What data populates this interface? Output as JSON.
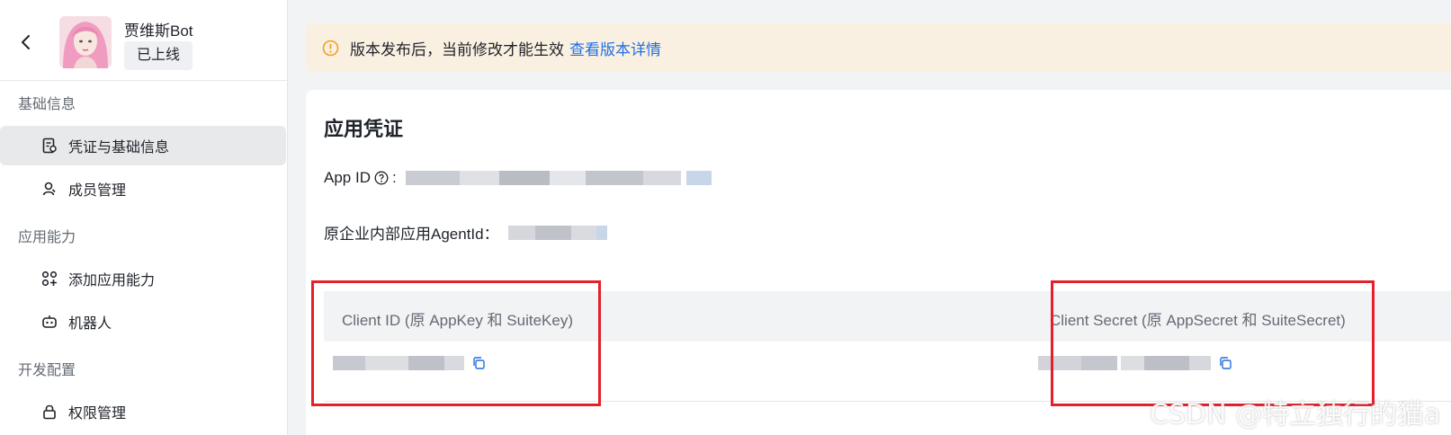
{
  "header": {
    "app_name": "贾维斯Bot",
    "status": "已上线"
  },
  "sidebar": {
    "groups": [
      {
        "label": "基础信息",
        "items": [
          {
            "label": "凭证与基础信息",
            "icon": "doc-badge-icon",
            "active": true
          },
          {
            "label": "成员管理",
            "icon": "person-icon",
            "active": false
          }
        ]
      },
      {
        "label": "应用能力",
        "items": [
          {
            "label": "添加应用能力",
            "icon": "grid-plus-icon",
            "active": false
          },
          {
            "label": "机器人",
            "icon": "robot-icon",
            "active": false
          }
        ]
      },
      {
        "label": "开发配置",
        "items": [
          {
            "label": "权限管理",
            "icon": "lock-icon",
            "active": false
          }
        ]
      }
    ]
  },
  "notice": {
    "text": "版本发布后，当前修改才能生效",
    "link": "查看版本详情"
  },
  "credentials": {
    "title": "应用凭证",
    "app_id_label": "App ID",
    "app_id_colon": ":",
    "agent_id_label": "原企业内部应用AgentId：",
    "client_id_header": "Client ID (原 AppKey 和 SuiteKey)",
    "client_secret_header": "Client Secret (原 AppSecret 和 SuiteSecret)"
  },
  "watermark": "CSDN @特立独行的猫a",
  "colors": {
    "accent": "#1f6fe5",
    "notice_bg": "#faf0e1",
    "notice_icon": "#f0a020",
    "highlight_box": "#e3202b"
  }
}
